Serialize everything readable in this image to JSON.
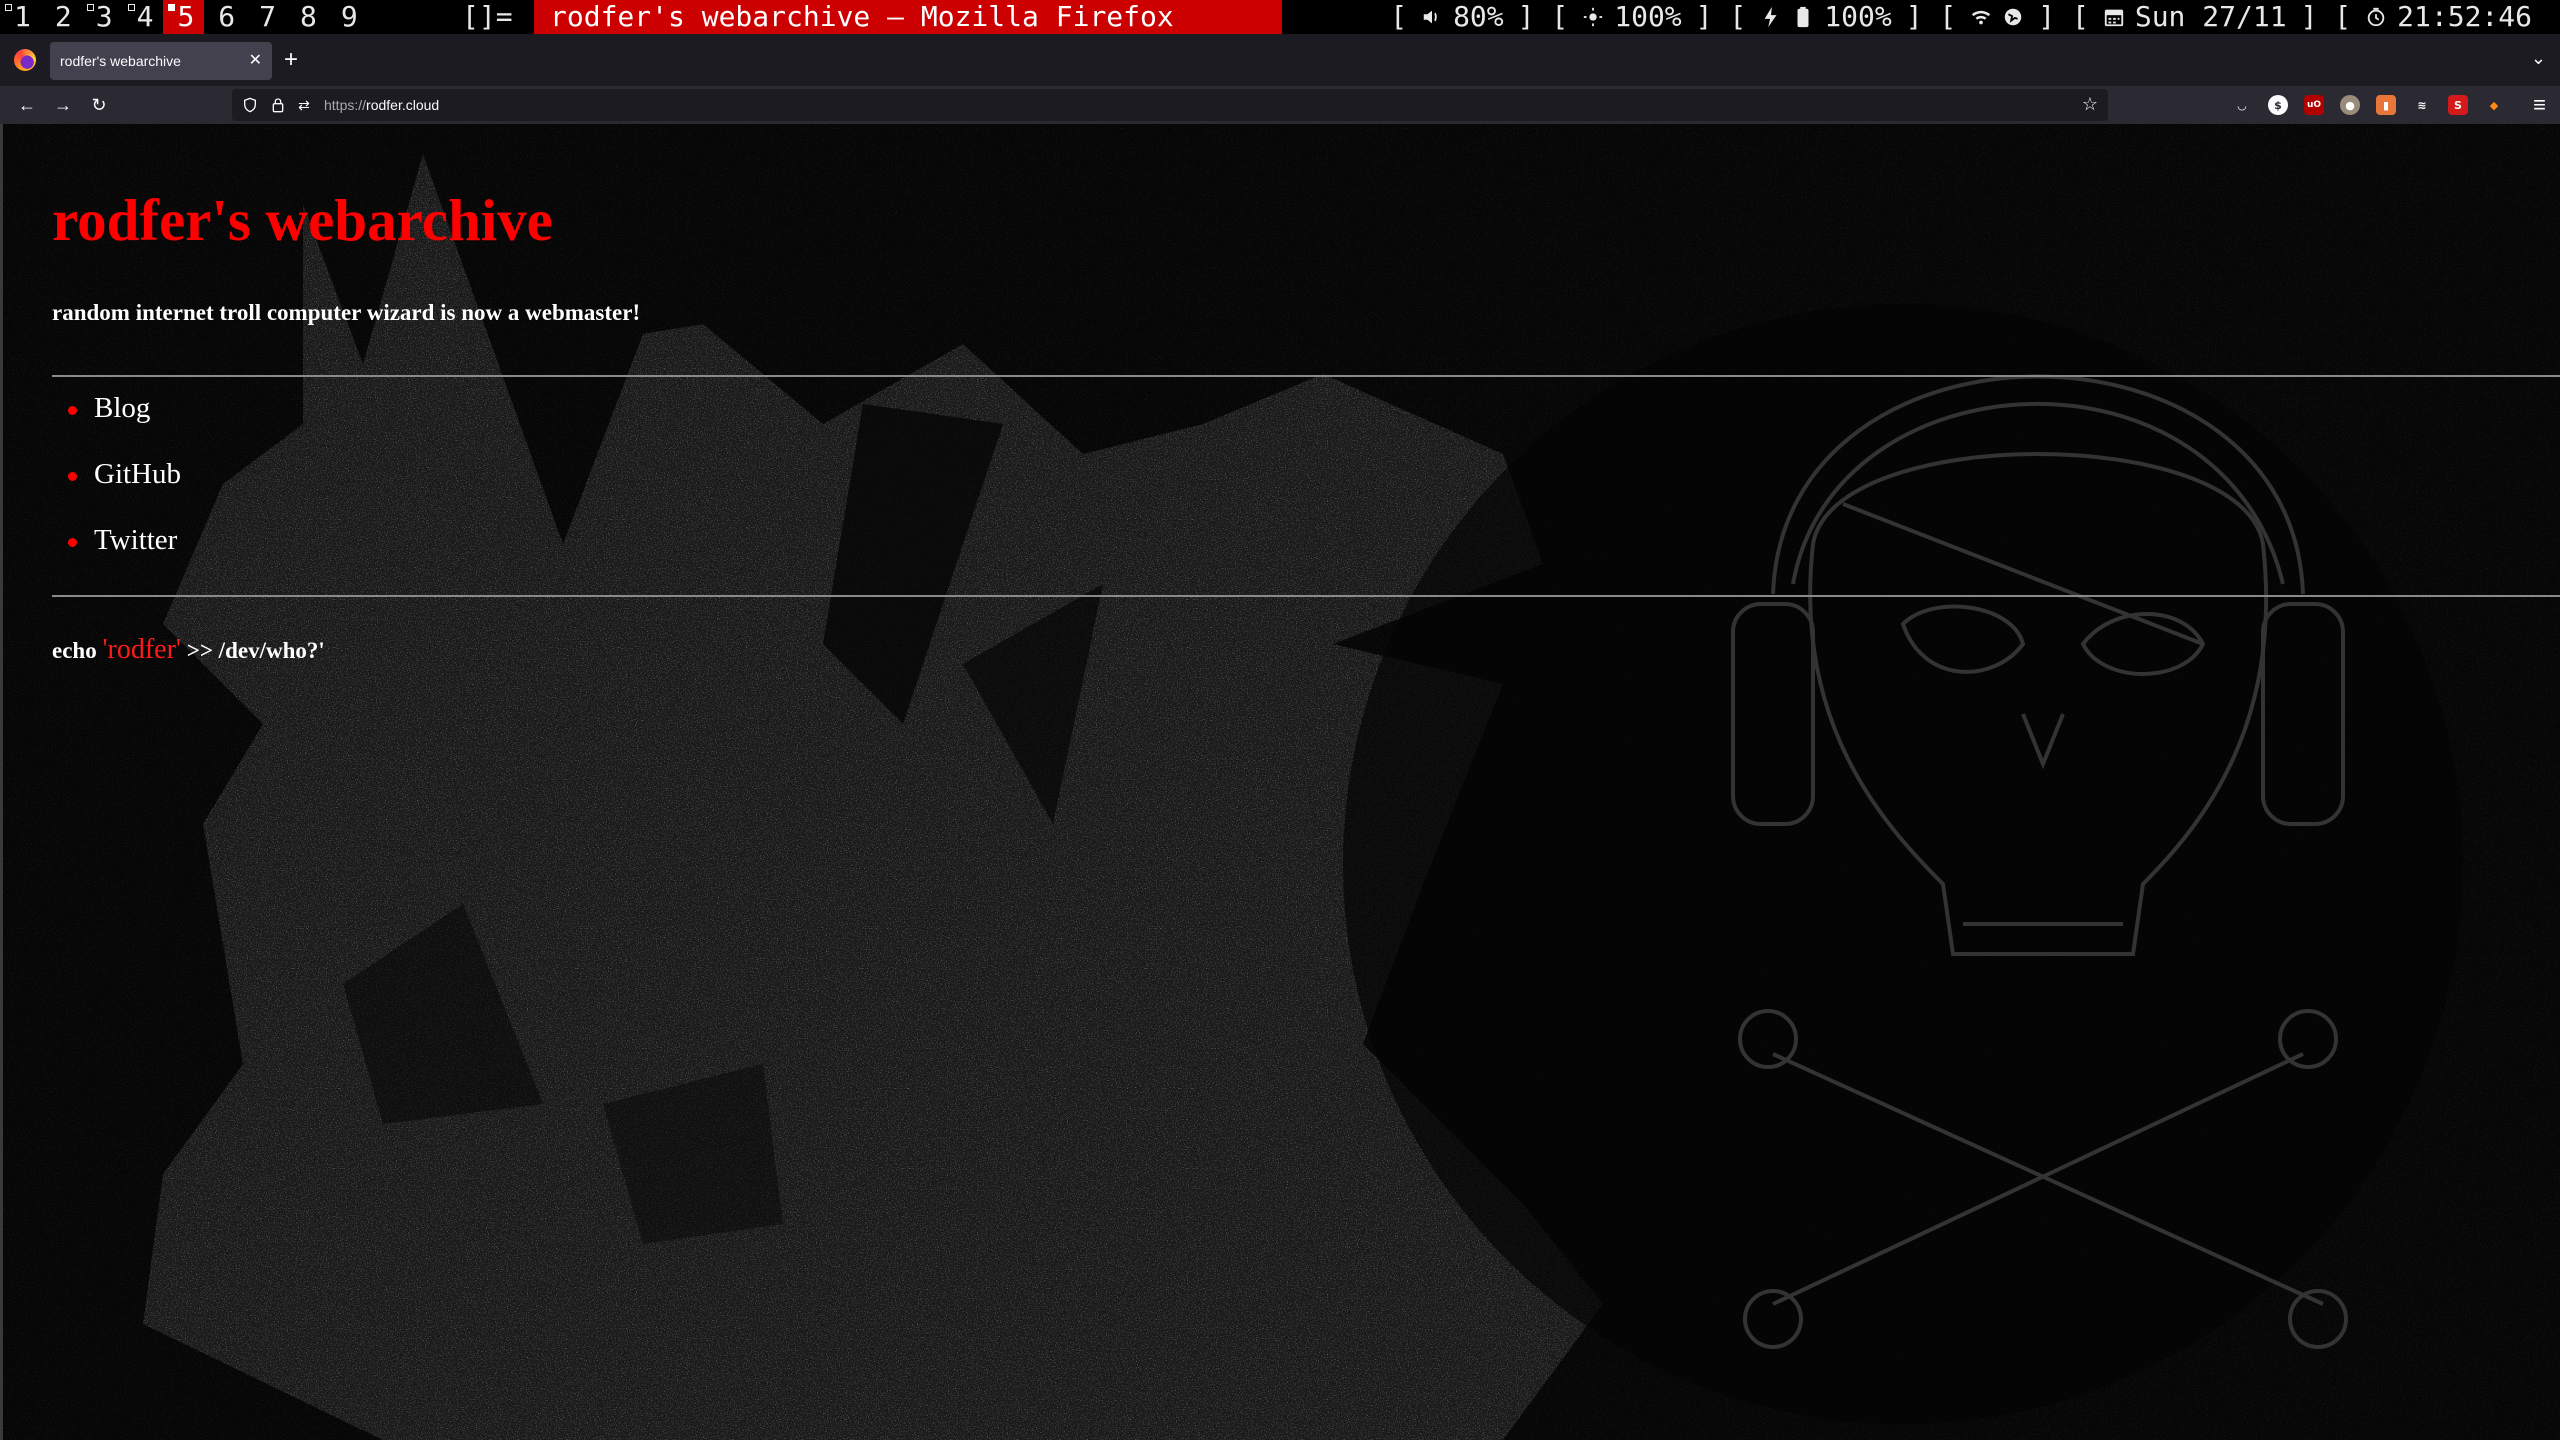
{
  "wm": {
    "tags": [
      "1",
      "2",
      "3",
      "4",
      "5",
      "6",
      "7",
      "8",
      "9"
    ],
    "active_tag": "5",
    "layout_symbol": "[]=",
    "window_title": "rodfer's webarchive — Mozilla Firefox",
    "status": {
      "volume": "80%",
      "brightness": "100%",
      "battery": "100%",
      "date": "Sun 27/11",
      "time": "21:52:46"
    },
    "colors": {
      "accent": "#cc0000",
      "bar_bg": "#000000"
    }
  },
  "browser": {
    "tab_title": "rodfer's webarchive",
    "url_protocol": "https://",
    "url_host": "rodfer.cloud",
    "new_tab_symbol": "+",
    "extensions": [
      "pocket-icon",
      "dollar-extension-icon",
      "ublock-icon",
      "monkey-extension-icon",
      "trash-extension-icon",
      "stack-extension-icon",
      "s-extension-icon",
      "fox-extension-icon"
    ]
  },
  "page": {
    "title": "rodfer's webarchive",
    "tagline": "random internet troll computer wizard is now a webmaster!",
    "links": [
      {
        "label": "Blog"
      },
      {
        "label": "GitHub"
      },
      {
        "label": "Twitter"
      }
    ],
    "footer": {
      "prefix": "echo ",
      "highlight": "'rodfer'",
      "suffix": " >> /dev/who?'"
    },
    "colors": {
      "title": "#ff0000",
      "bullet": "#ff0000",
      "background": "#060606"
    }
  }
}
